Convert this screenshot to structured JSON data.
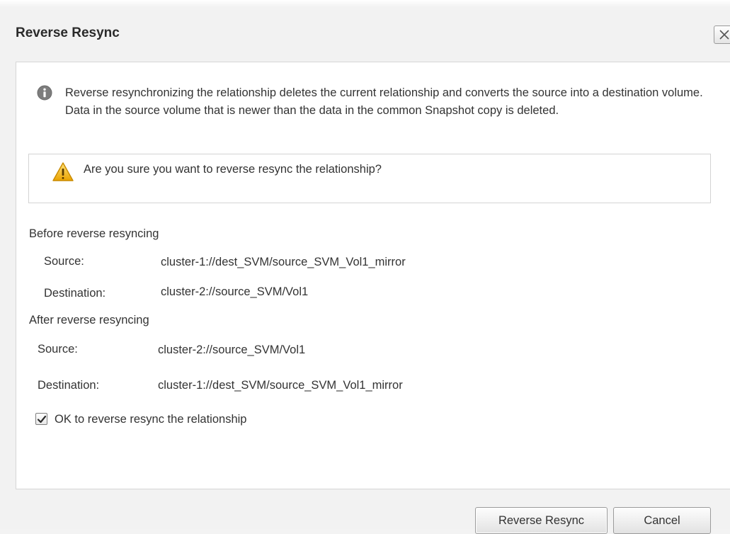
{
  "dialog": {
    "title": "Reverse Resync",
    "close_icon": "close-icon"
  },
  "info": {
    "icon": "info-icon",
    "text": "Reverse resynchronizing the relationship deletes the current relationship and converts the source into a destination volume. Data in the source volume that is newer than the data in the common Snapshot copy is deleted."
  },
  "warning": {
    "icon": "warning-icon",
    "text": "Are you sure you want to reverse resync the relationship?"
  },
  "before": {
    "heading": "Before reverse resyncing",
    "source_label": "Source:",
    "source_value": "cluster-1://dest_SVM/source_SVM_Vol1_mirror",
    "destination_label": "Destination:",
    "destination_value": "cluster-2://source_SVM/Vol1"
  },
  "after": {
    "heading": "After reverse resyncing",
    "source_label": "Source:",
    "source_value": "cluster-2://source_SVM/Vol1",
    "destination_label": "Destination:",
    "destination_value": "cluster-1://dest_SVM/source_SVM_Vol1_mirror"
  },
  "confirm": {
    "label": "OK to reverse resync the relationship",
    "checked": true
  },
  "buttons": {
    "primary": "Reverse Resync",
    "cancel": "Cancel"
  },
  "colors": {
    "info_icon": "#7d7d7d",
    "warning_icon": "#f0b400",
    "panel_background": "#ffffff",
    "dialog_background": "#f2f2f2"
  }
}
